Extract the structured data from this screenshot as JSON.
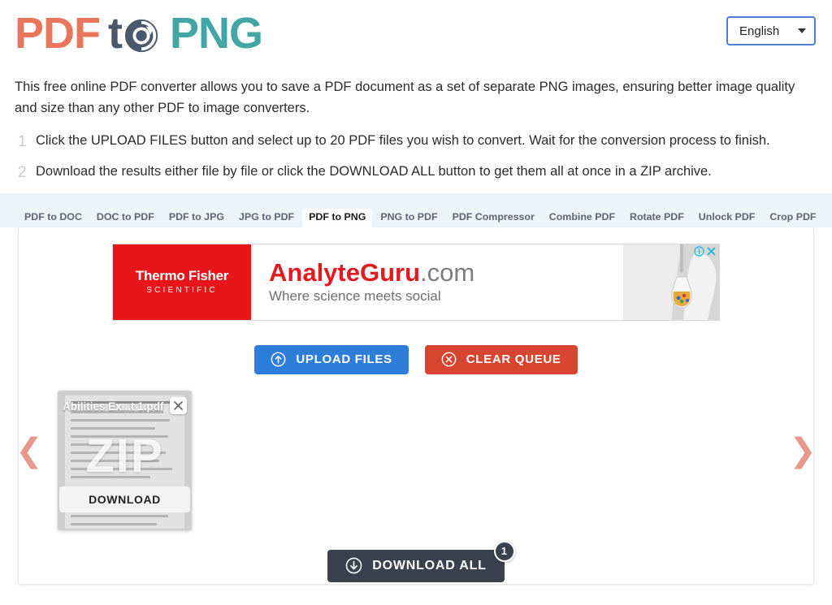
{
  "header": {
    "logo": {
      "part1": "PDF",
      "part2": "t",
      "icon": "refresh-circle-icon",
      "part3": "PNG"
    },
    "language": {
      "value": "English",
      "icon": "chevron-down-icon"
    }
  },
  "intro": {
    "description": "This free online PDF converter allows you to save a PDF document as a set of separate PNG images, ensuring better image quality and size than any other PDF to image converters."
  },
  "steps": [
    {
      "num": "1",
      "text": "Click the UPLOAD FILES button and select up to 20 PDF files you wish to convert. Wait for the conversion process to finish."
    },
    {
      "num": "2",
      "text": "Download the results either file by file or click the DOWNLOAD ALL button to get them all at once in a ZIP archive."
    }
  ],
  "tabs": [
    {
      "label": "PDF to DOC",
      "active": false
    },
    {
      "label": "DOC to PDF",
      "active": false
    },
    {
      "label": "PDF to JPG",
      "active": false
    },
    {
      "label": "JPG to PDF",
      "active": false
    },
    {
      "label": "PDF to PNG",
      "active": true
    },
    {
      "label": "PNG to PDF",
      "active": false
    },
    {
      "label": "PDF Compressor",
      "active": false
    },
    {
      "label": "Combine PDF",
      "active": false
    },
    {
      "label": "Rotate PDF",
      "active": false
    },
    {
      "label": "Unlock PDF",
      "active": false
    },
    {
      "label": "Crop PDF",
      "active": false
    }
  ],
  "ad": {
    "sponsor_name": "Thermo Fisher",
    "sponsor_sub": "SCIENTIFIC",
    "title": "AnalyteGuru",
    "title_tld": ".com",
    "subtitle": "Where science meets social",
    "info_icon": "adchoices-info-icon",
    "close_icon": "ad-close-icon"
  },
  "actions": {
    "upload": {
      "label": "UPLOAD FILES",
      "icon": "upload-arrow-circle-icon"
    },
    "clear": {
      "label": "CLEAR QUEUE",
      "icon": "close-circle-icon"
    }
  },
  "carousel": {
    "prev_icon": "chevron-left-icon",
    "next_icon": "chevron-right-icon",
    "items": [
      {
        "filename": "Abilities Ex...t 1.pdf",
        "watermark": "ZIP",
        "download_label": "DOWNLOAD",
        "close_icon": "close-icon"
      }
    ]
  },
  "download_all": {
    "label": "DOWNLOAD ALL",
    "icon": "download-arrow-circle-icon",
    "badge_count": "1"
  },
  "colors": {
    "logo_pdf": "#e8765c",
    "logo_to": "#49586a",
    "logo_png": "#42a6a2",
    "upload_blue": "#2f7ddb",
    "clear_red": "#d7442f",
    "dark_slate": "#39414f",
    "arrow_salmon": "#e8978b",
    "tabbar_bg": "#eef2f9"
  }
}
